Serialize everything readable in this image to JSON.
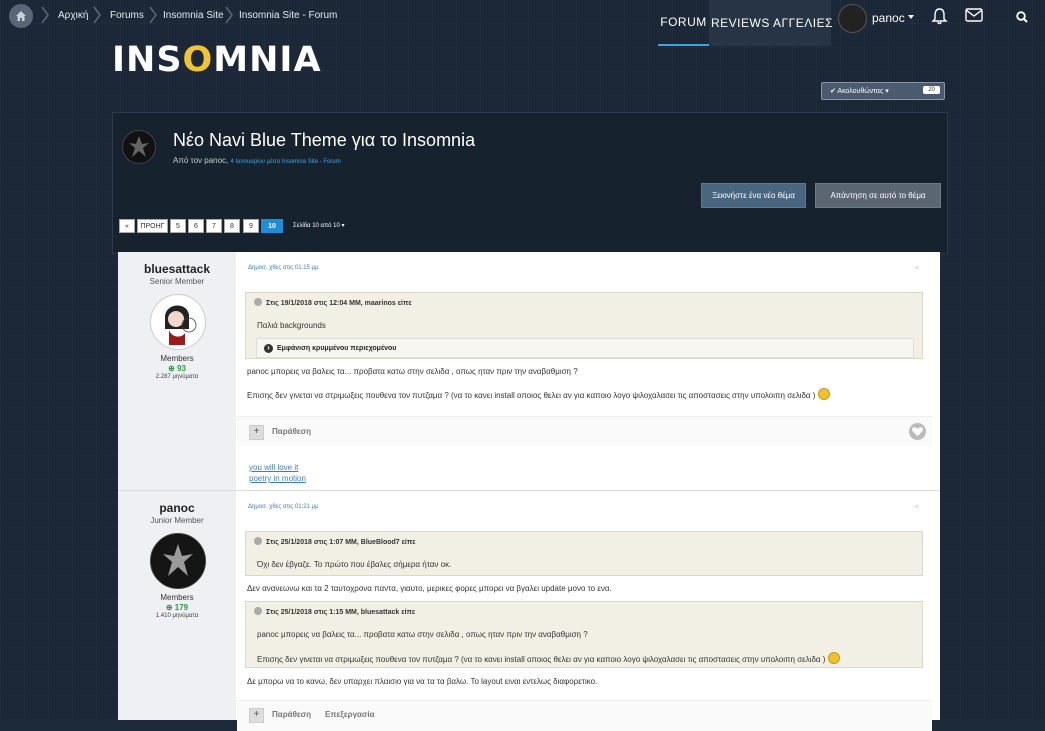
{
  "breadcrumb": {
    "home": "Αρχική",
    "items": [
      "Forums",
      "Insomnia Site",
      "Insomnia Site - Forum"
    ]
  },
  "nav": {
    "forum": "FORUM",
    "reviews": "REVIEWS",
    "ads": "ΑΓΓΕΛΙΕΣ"
  },
  "user": {
    "name": "panoc"
  },
  "logo": {
    "before": "INS",
    "moon": "O",
    "after": "MNIA"
  },
  "follow": {
    "label": "✔ Ακολουθώντας ▾",
    "count": "20"
  },
  "topic": {
    "title": "Νέο Navi Blue Theme για το Insomnia",
    "by": "Από τον panoc,",
    "meta": "4 Ιανουαρίου μέσα Insomnia Site - Forum",
    "new_topic": "Ξεκινήστε ένα νέο θέμα",
    "reply": "Απάντηση σε αυτό το θέμα"
  },
  "pagination": {
    "first": "«",
    "prev": "ΠΡΟΗΓ",
    "pages": [
      "5",
      "6",
      "7",
      "8",
      "9",
      "10"
    ],
    "info": "Σελίδα 10 από 10 ▾"
  },
  "posts": [
    {
      "author": "bluesattack",
      "rank": "Senior Member",
      "group": "Members",
      "rep": "⊕ 93",
      "count": "2.287 μηνύματα",
      "date": "Δημοσ. χθες στις 01:15 μμ",
      "quote_head": "Στις 19/1/2018 στις 12:04 ΜΜ, maarinos είπε",
      "quote_text": "Παλιά backgrounds",
      "hidden": "Εμφάνιση κρυμμένου περιεχομένου",
      "line1": "panoc μπορεις να βαλεις τα... προβατα  κατω στην σελιδα , οπως ηταν πριν την αναβαθμιση ?",
      "line2": "Επισης δεν γινεται να στριμωξεις πουθενα τον πυτζαμα ?  (να το κανει install οποιος θελει αν για καποιο  λογο ψιλοχαλασει τις αποστασεις στην υπολοιπη  σελιδα )",
      "quote_action": "Παράθεση",
      "sig1": "you will love it",
      "sig2": "poetry in motion"
    },
    {
      "author": "panoc",
      "rank": "Junior Member",
      "group": "Members",
      "rep": "⊕ 179",
      "count": "1.410 μηνύματα",
      "date": "Δημοσ. χθες στις 01:21 μμ",
      "quote1_head": "Στις 25/1/2018 στις 1:07 ΜΜ, BlueBlood7 είπε",
      "quote1_text": "Όχι δεν έβγαζε. Το πρώτο που έβαλες σήμερα ήταν οκ.",
      "line1": "Δεν ανανεωνω και τα 2 ταυτοχρονα παντα, γιαυτο, μερικες φορες μπορει να βγαλει update μονο το ενα.",
      "quote2_head": "Στις 25/1/2018 στις 1:15 ΜΜ, bluesattack είπε",
      "quote2_text1": "panoc μπορεις να βαλεις τα... προβατα  κατω στην σελιδα , οπως ηταν πριν την αναβαθμιση ?",
      "quote2_text2": "Επισης δεν γινεται να στριμωξεις πουθενα τον πυτζαμα ?  (να το κανει install οποιος θελει αν για καποιο  λογο ψιλοχαλασει τις αποστασεις στην υπολοιπη  σελιδα )",
      "line2": "Δε μπορω να το κανω, δεν υπαρχει πλαισιο για να τα τα βαλω. Το layout ειναι εντελως διαφορετικο.",
      "quote_action": "Παράθεση",
      "edit_action": "Επεξεργασία"
    }
  ],
  "colors": {
    "accent": "#3fa5e0",
    "bg": "#1c2838",
    "active_page": "#1f8ed6",
    "rep": "#2e9b43"
  }
}
